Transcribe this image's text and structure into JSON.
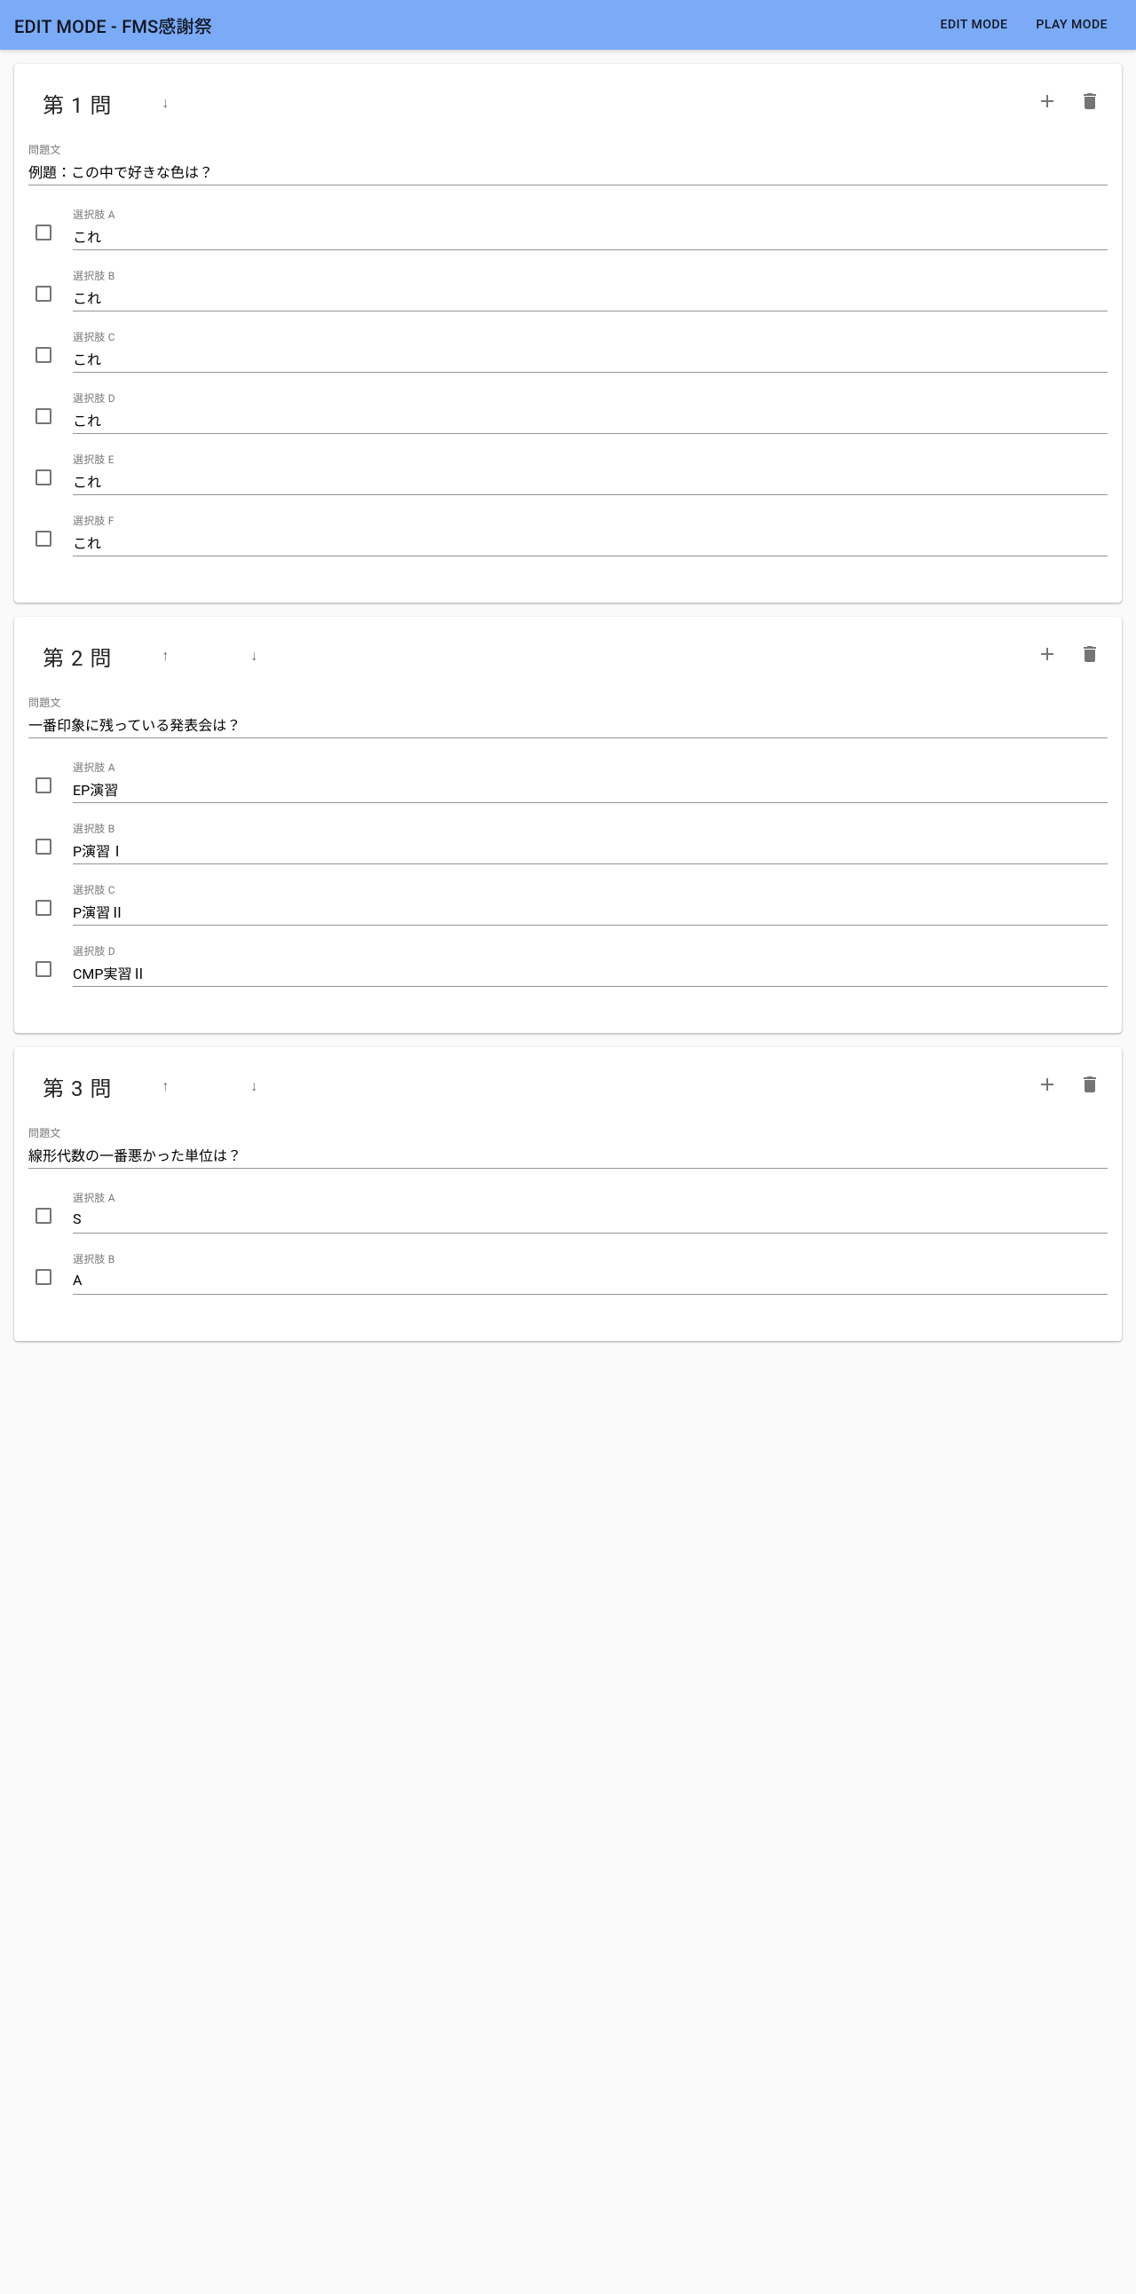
{
  "appbar": {
    "title": "EDIT MODE - FMS感謝祭",
    "edit_mode": "EDIT MODE",
    "play_mode": "PLAY MODE"
  },
  "arrows": {
    "up": "↑",
    "down": "↓"
  },
  "labels": {
    "question_text": "問題文",
    "option_prefix": "選択肢"
  },
  "questions": [
    {
      "title": "第 1 問",
      "show_up": false,
      "show_down": true,
      "text": "例題：この中で好きな色は？",
      "options": [
        {
          "letter": "A",
          "value": "これ"
        },
        {
          "letter": "B",
          "value": "これ"
        },
        {
          "letter": "C",
          "value": "これ"
        },
        {
          "letter": "D",
          "value": "これ"
        },
        {
          "letter": "E",
          "value": "これ"
        },
        {
          "letter": "F",
          "value": "これ"
        }
      ]
    },
    {
      "title": "第 2 問",
      "show_up": true,
      "show_down": true,
      "text": "一番印象に残っている発表会は？",
      "options": [
        {
          "letter": "A",
          "value": "EP演習"
        },
        {
          "letter": "B",
          "value": "P演習Ⅰ"
        },
        {
          "letter": "C",
          "value": "P演習Ⅱ"
        },
        {
          "letter": "D",
          "value": "CMP実習Ⅱ"
        }
      ]
    },
    {
      "title": "第 3 問",
      "show_up": true,
      "show_down": true,
      "text": "線形代数の一番悪かった単位は？",
      "options": [
        {
          "letter": "A",
          "value": "S"
        },
        {
          "letter": "B",
          "value": "A"
        }
      ]
    }
  ]
}
